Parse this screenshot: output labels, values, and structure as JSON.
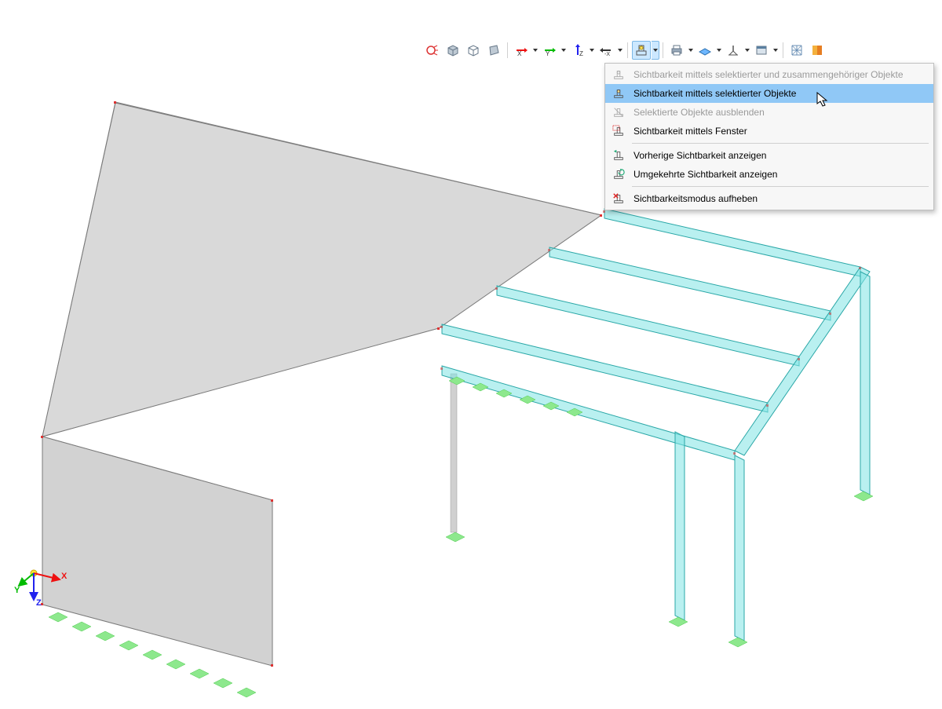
{
  "toolbar": {
    "iso_label": "ISO",
    "axes": {
      "x": "X",
      "y": "Y",
      "z": "Z",
      "neg_x": "-X"
    }
  },
  "menu": {
    "items": [
      {
        "label": "Sichtbarkeit mittels selektierter und zusammengehöriger Objekte",
        "disabled": true
      },
      {
        "label": "Sichtbarkeit mittels selektierter Objekte",
        "highlight": true
      },
      {
        "label": "Selektierte Objekte ausblenden",
        "disabled": true
      },
      {
        "label": "Sichtbarkeit mittels Fenster"
      }
    ],
    "items2": [
      {
        "label": "Vorherige Sichtbarkeit anzeigen"
      },
      {
        "label": "Umgekehrte Sichtbarkeit anzeigen"
      }
    ],
    "items3": [
      {
        "label": "Sichtbarkeitsmodus aufheben"
      }
    ]
  },
  "gizmo": {
    "x": "X",
    "y": "Y",
    "z": "Z"
  }
}
